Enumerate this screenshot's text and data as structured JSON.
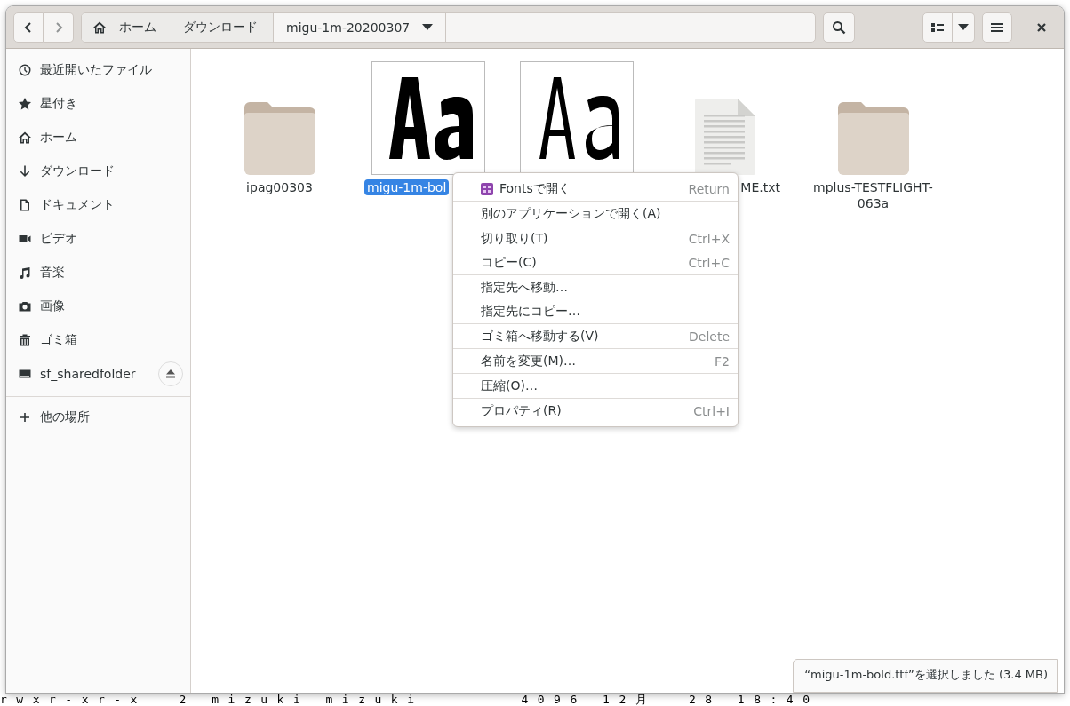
{
  "terminal": {
    "line": "rwxr-xr-x  2 mizuki mizuki      4096 12月  28 18:40"
  },
  "toolbar": {
    "back": {
      "disabled": false
    },
    "forward": {
      "disabled": true
    },
    "path": [
      {
        "label": "ホーム",
        "kind": "home",
        "selected": false
      },
      {
        "label": "ダウンロード",
        "kind": "plain",
        "selected": false
      },
      {
        "label": "migu-1m-20200307",
        "kind": "current",
        "selected": true
      }
    ]
  },
  "sidebar": {
    "items": [
      {
        "label": "最近開いたファイル",
        "kind": "recent"
      },
      {
        "label": "星付き",
        "kind": "starred"
      },
      {
        "label": "ホーム",
        "kind": "home"
      },
      {
        "label": "ダウンロード",
        "kind": "downloads"
      },
      {
        "label": "ドキュメント",
        "kind": "documents"
      },
      {
        "label": "ビデオ",
        "kind": "videos"
      },
      {
        "label": "音楽",
        "kind": "music"
      },
      {
        "label": "画像",
        "kind": "pictures"
      },
      {
        "label": "ゴミ箱",
        "kind": "trash"
      },
      {
        "label": "sf_sharedfolder",
        "kind": "drive",
        "ejectable": true
      }
    ],
    "other": {
      "label": "他の場所"
    }
  },
  "files": [
    {
      "label": "ipag00303",
      "kind": "folder",
      "selected": false
    },
    {
      "label": "migu-1m-bol",
      "kind": "font-bold",
      "selected": true
    },
    {
      "kind": "font-regular",
      "selected": false
    },
    {
      "label": "ME.txt",
      "kind": "text",
      "selected": false
    },
    {
      "label": "mplus-TESTFLIGHT-063a",
      "kind": "folder",
      "selected": false
    }
  ],
  "context_menu": {
    "sections": [
      [
        {
          "label": "Fontsで開く",
          "shortcut": "Return",
          "icon": true
        }
      ],
      [
        {
          "label": "別のアプリケーションで開く(A)"
        }
      ],
      [
        {
          "label": "切り取り(T)",
          "shortcut": "Ctrl+X"
        },
        {
          "label": "コピー(C)",
          "shortcut": "Ctrl+C"
        }
      ],
      [
        {
          "label": "指定先へ移動…"
        },
        {
          "label": "指定先にコピー…"
        }
      ],
      [
        {
          "label": "ゴミ箱へ移動する(V)",
          "shortcut": "Delete"
        }
      ],
      [
        {
          "label": "名前を変更(M)…",
          "shortcut": "F2"
        }
      ],
      [
        {
          "label": "圧縮(O)…"
        }
      ],
      [
        {
          "label": "プロパティ(R)",
          "shortcut": "Ctrl+I"
        }
      ]
    ]
  },
  "status": {
    "text": "“migu-1m-bold.ttf”を選択しました (3.4 MB)"
  }
}
